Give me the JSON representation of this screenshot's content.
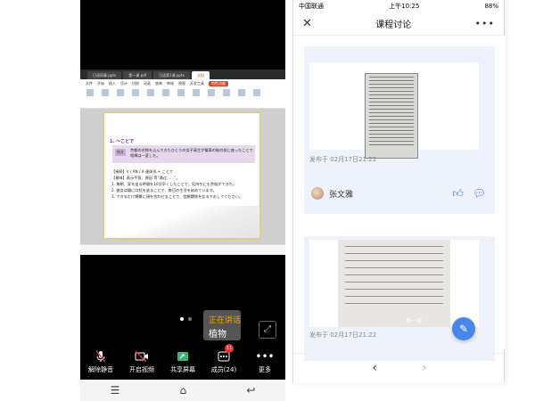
{
  "meeting": {
    "wps_tabs": [
      "日语同事.pptx",
      "第一课.pdf",
      "日语第1课.pptx",
      "文档"
    ],
    "wps_menu": [
      "文件",
      "开始",
      "插入",
      "设计",
      "切换",
      "动画",
      "放映",
      "审阅",
      "视图",
      "开发工具",
      "特色功能"
    ],
    "slide": {
      "title": "1. ～ことで",
      "example_tag": "例文",
      "example_text": "京都の名物を込んできたひとりの女子高生が電車の駅の前に座ったことで喧嘩は一変した。",
      "lines": [
        "【接続】V / AN / A 連体形 + ことで",
        "【意味】表示手段、原因 等\"通过……\"。",
        "1. 毎朝、家を出る時間を10分早くしたことで、気持ちにも余裕ができた。",
        "2. 彼女は鏡に口紅を塗ることで、毎日の生活を始めています。",
        "3. できるだけ頻繁に顔を合わせることで、信頼関係をなるでおしてください。"
      ]
    },
    "tooltip_top": "正在讲话",
    "tooltip_name": "植物",
    "toolbar": [
      {
        "label": "解除静音",
        "icon": "mic-muted-icon"
      },
      {
        "label": "开启视频",
        "icon": "camera-off-icon"
      },
      {
        "label": "共享屏幕",
        "icon": "share-screen-icon"
      },
      {
        "label": "成员(24)",
        "icon": "members-icon",
        "badge": "11"
      },
      {
        "label": "更多",
        "icon": "more-icon"
      }
    ]
  },
  "phone": {
    "status": {
      "carrier": "中国联通",
      "time": "上午10:25",
      "battery": "88%"
    },
    "title": "课程讨论",
    "posts": [
      {
        "caption": "发布于 02月17日21:22",
        "author": "张文雅"
      },
      {
        "caption": "发布于 02月17日21:22",
        "slide_label": "第一课"
      }
    ]
  }
}
